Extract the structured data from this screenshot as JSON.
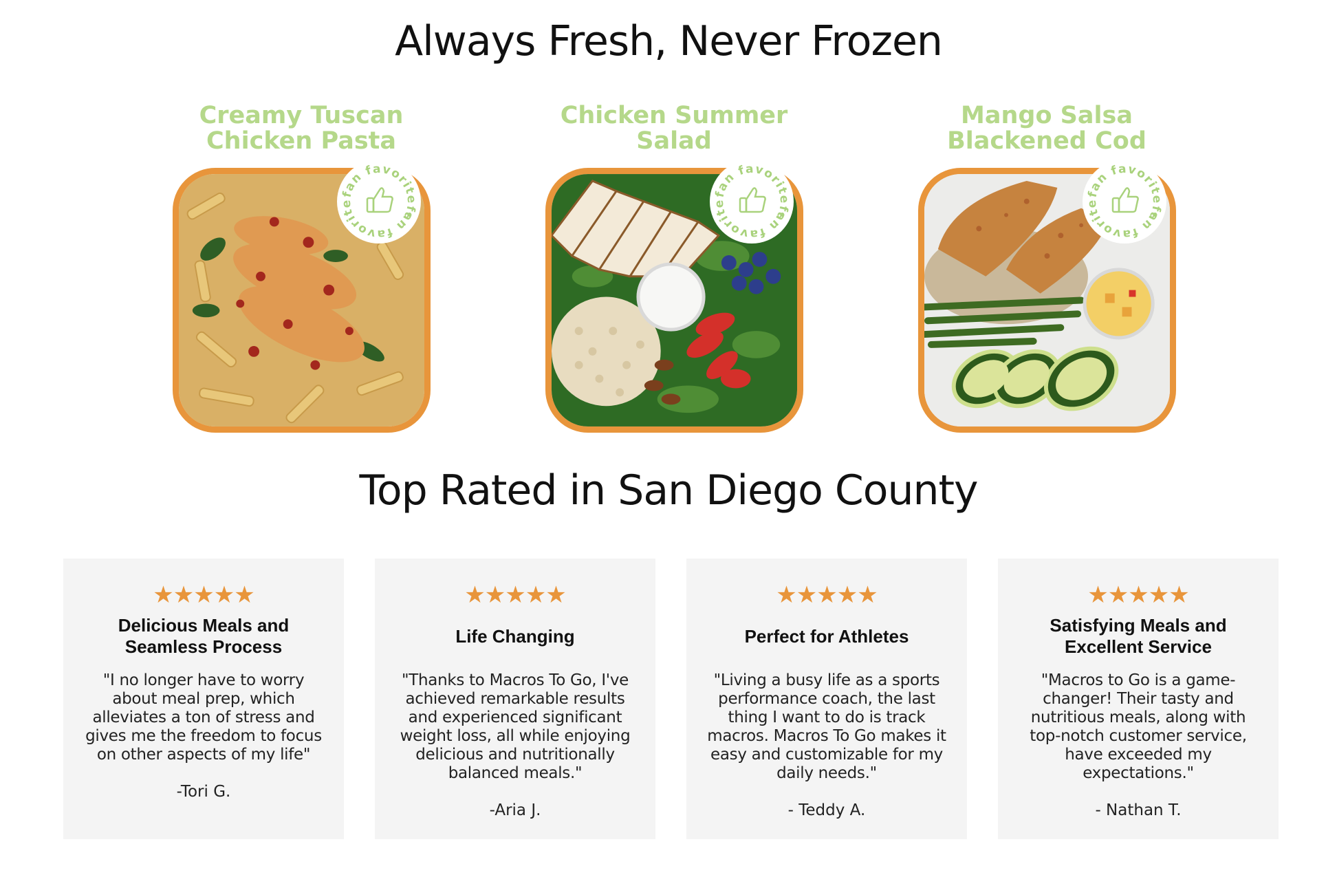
{
  "section1": {
    "title": "Always Fresh, Never Frozen"
  },
  "meals": [
    {
      "name": "Creamy Tuscan\nChicken Pasta",
      "badge": "fan favorite",
      "image": "chicken-pasta-photo"
    },
    {
      "name": "Chicken Summer\nSalad",
      "badge": "fan favorite",
      "image": "chicken-salad-photo"
    },
    {
      "name": "Mango Salsa\nBlackened Cod",
      "badge": "fan favorite",
      "image": "blackened-cod-photo"
    }
  ],
  "section2": {
    "title": "Top Rated in San Diego County"
  },
  "reviews": [
    {
      "stars": "★★★★★",
      "title": "Delicious Meals and\nSeamless Process",
      "text": "\"I no longer have to worry about meal prep, which alleviates a ton of stress and gives me the freedom to focus on other aspects of my life\"",
      "author": "-Tori G."
    },
    {
      "stars": "★★★★★",
      "title": "Life Changing",
      "text": "\"Thanks to Macros To Go, I've achieved remarkable results and experienced significant weight loss, all while enjoying delicious and nutritionally balanced meals.\"",
      "author": "-Aria J."
    },
    {
      "stars": "★★★★★",
      "title": "Perfect for Athletes",
      "text": "\"Living a busy life as a sports performance coach, the last thing I want to do is track macros. Macros To Go makes it easy and customizable for my daily needs.\"",
      "author": "- Teddy A."
    },
    {
      "stars": "★★★★★",
      "title": "Satisfying Meals and\nExcellent Service",
      "text": "\"Macros to Go is a game-changer! Their tasty and nutritious meals, along with top-notch customer service, have exceeded my expectations.\"",
      "author": "- Nathan T."
    }
  ],
  "colors": {
    "accent_orange": "#e8953b",
    "accent_green": "#b5d88a",
    "card_bg": "#f4f4f4"
  }
}
